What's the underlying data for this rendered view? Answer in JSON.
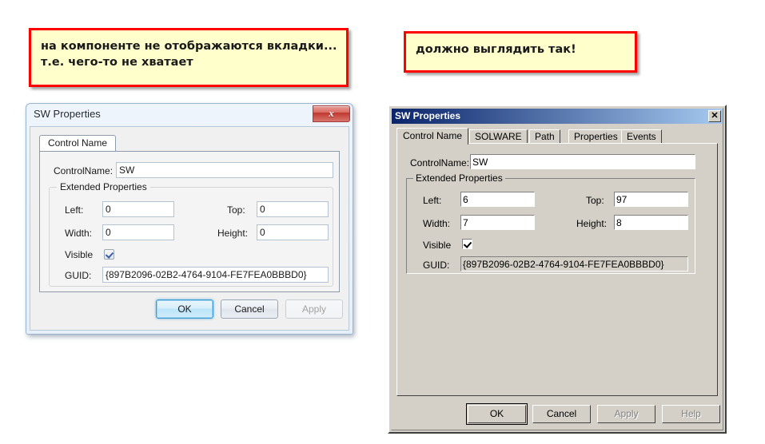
{
  "callouts": {
    "left": {
      "line1": "на компоненте не отображаются вкладки...",
      "line2": "т.е. чего-то не хватает",
      "border_color": "#ff0000",
      "fill_color": "#ffffcc"
    },
    "right": {
      "line1": "должно выглядить так!",
      "border_color": "#ff0000",
      "fill_color": "#ffffcc"
    }
  },
  "dialog_broken": {
    "title": "SW Properties",
    "close_icon": "close-icon",
    "close_glyph": "x",
    "tabs": [
      {
        "label": "Control Name",
        "active": true
      }
    ],
    "fields": {
      "control_name_label": "ControlName:",
      "control_name_value": "SW",
      "group_legend": "Extended Properties",
      "left_label": "Left:",
      "left_value": "0",
      "top_label": "Top:",
      "top_value": "0",
      "width_label": "Width:",
      "width_value": "0",
      "height_label": "Height:",
      "height_value": "0",
      "visible_label": "Visible",
      "visible_checked": true,
      "guid_label": "GUID:",
      "guid_value": "{897B2096-02B2-4764-9104-FE7FEA0BBBD0}"
    },
    "buttons": [
      {
        "label": "OK",
        "state": "default"
      },
      {
        "label": "Cancel",
        "state": "normal"
      },
      {
        "label": "Apply",
        "state": "disabled"
      }
    ]
  },
  "dialog_expected": {
    "title": "SW Properties",
    "close_icon": "close-icon",
    "close_glyph": "✕",
    "tabs": [
      {
        "label": "Control Name",
        "active": true
      },
      {
        "label": "SOLWARE",
        "active": false
      },
      {
        "label": "Path",
        "active": false
      },
      {
        "label": "Properties",
        "active": false
      },
      {
        "label": "Events",
        "active": false
      }
    ],
    "fields": {
      "control_name_label": "ControlName:",
      "control_name_value": "SW",
      "group_legend": "Extended Properties",
      "left_label": "Left:",
      "left_value": "6",
      "top_label": "Top:",
      "top_value": "97",
      "width_label": "Width:",
      "width_value": "7",
      "height_label": "Height:",
      "height_value": "8",
      "visible_label": "Visible",
      "visible_checked": true,
      "guid_label": "GUID:",
      "guid_value": "{897B2096-02B2-4764-9104-FE7FEA0BBBD0}"
    },
    "buttons": [
      {
        "label": "OK",
        "state": "default"
      },
      {
        "label": "Cancel",
        "state": "normal"
      },
      {
        "label": "Apply",
        "state": "disabled"
      },
      {
        "label": "Help",
        "state": "disabled"
      }
    ]
  }
}
